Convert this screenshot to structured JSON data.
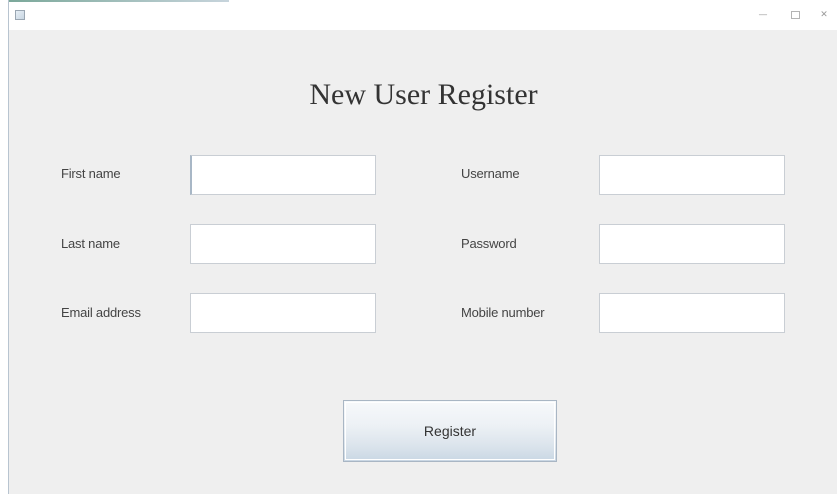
{
  "window": {
    "controls": {
      "minimize": "—",
      "maximize": "",
      "close": "✕"
    }
  },
  "form": {
    "title": "New User Register",
    "left_fields": [
      {
        "label": "First name",
        "value": ""
      },
      {
        "label": "Last name",
        "value": ""
      },
      {
        "label": "Email address",
        "value": ""
      }
    ],
    "right_fields": [
      {
        "label": "Username",
        "value": ""
      },
      {
        "label": "Password",
        "value": ""
      },
      {
        "label": "Mobile number",
        "value": ""
      }
    ],
    "submit_label": "Register"
  },
  "colors": {
    "window_background": "#efefef",
    "titlebar_background": "#ffffff",
    "field_border": "#c9ced4",
    "button_gradient_bottom": "#c9d7e4"
  }
}
